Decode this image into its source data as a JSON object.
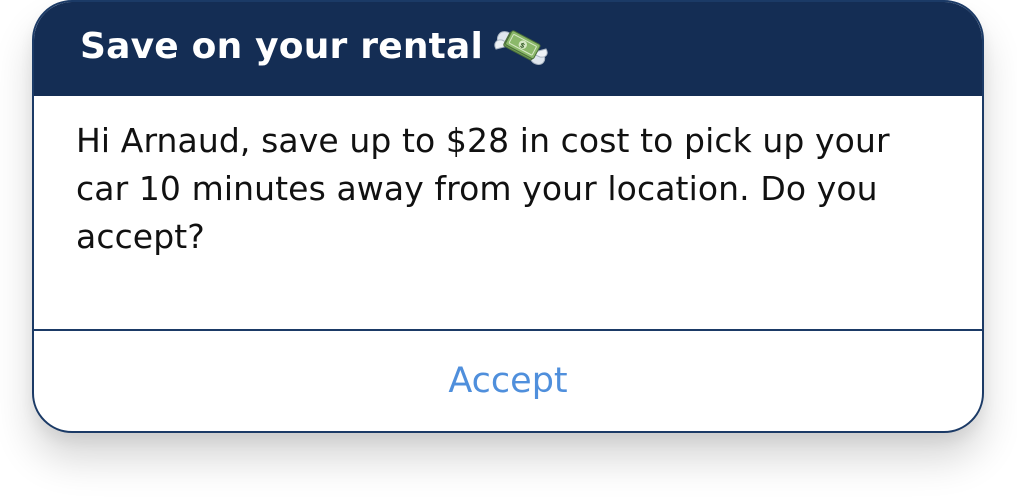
{
  "popup": {
    "title": "Save on your rental",
    "title_icon": "flying-money-icon",
    "message": "Hi Arnaud, save up to $28 in cost to pick up your car 10 minutes away from your location. Do you accept?",
    "accept_label": "Accept"
  },
  "colors": {
    "header_bg": "#142d54",
    "border": "#1b3a66",
    "accent": "#4f8fdc",
    "text": "#111111"
  }
}
